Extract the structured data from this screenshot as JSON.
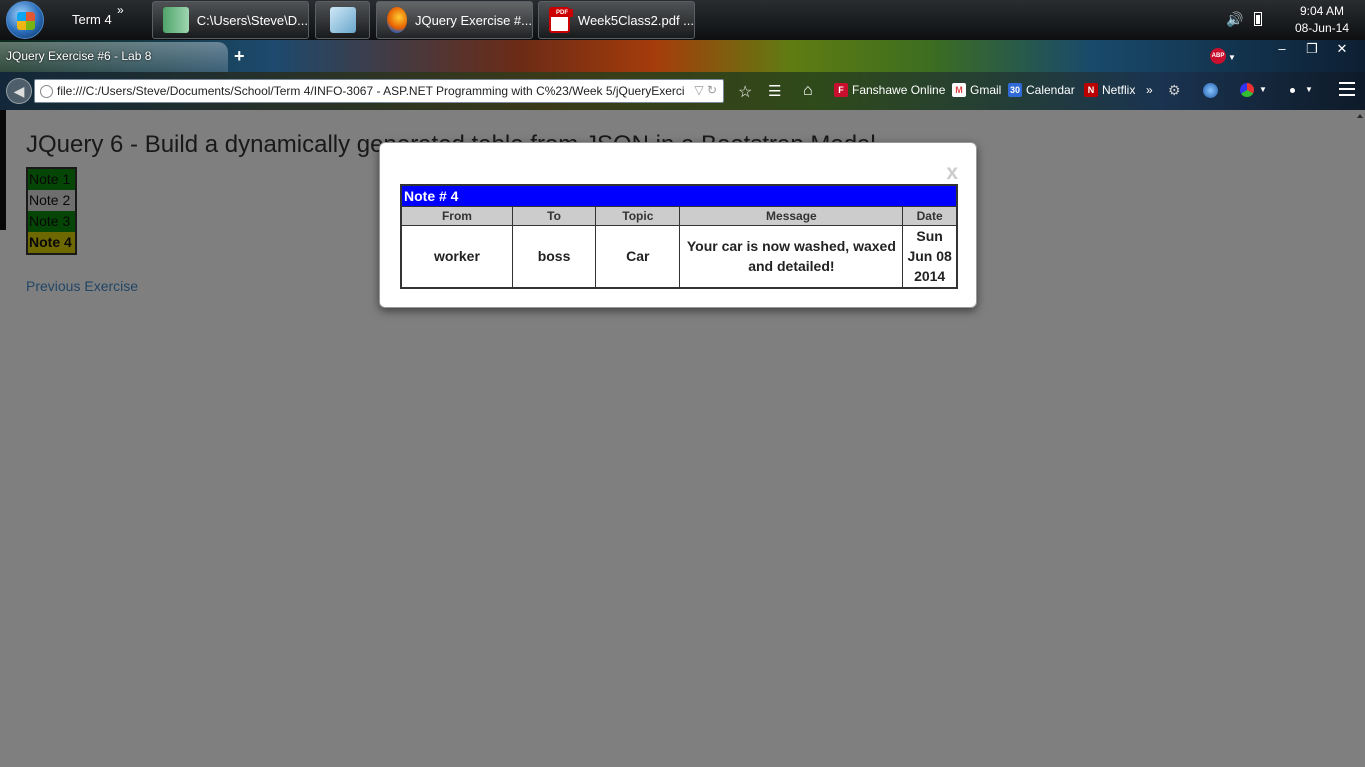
{
  "taskbar": {
    "toolbar_label": "Term 4",
    "toolbar_chevron": "»",
    "apps": [
      {
        "label": "C:\\Users\\Steve\\D..."
      },
      {
        "label": ""
      },
      {
        "label": "JQuery Exercise #..."
      },
      {
        "label": "Week5Class2.pdf ..."
      }
    ],
    "time": "9:04 AM",
    "date": "08-Jun-14"
  },
  "browser": {
    "tab_title": "JQuery Exercise #6 - Lab 8",
    "new_tab": "+",
    "url": "file:///C:/Users/Steve/Documents/School/Term 4/INFO-3067 - ASP.NET Programming with C%23/Week 5/jQueryExerci",
    "bookmarks": [
      {
        "label": "Fanshawe Online",
        "icon": "fanshawe-icon"
      },
      {
        "label": "Gmail",
        "icon": "gmail-icon"
      },
      {
        "label": "Calendar",
        "icon": "calendar-icon"
      },
      {
        "label": "Netflix",
        "icon": "netflix-icon"
      }
    ],
    "bookmarks_overflow": "»",
    "abp_label": "ABP"
  },
  "page": {
    "title": "JQuery 6 - Build a dynamically generated table from JSON in a Bootstrap Modal",
    "notes": [
      "Note 1",
      "Note 2",
      "Note 3",
      "Note 4"
    ],
    "previous_link": "Previous Exercise"
  },
  "modal": {
    "close": "x",
    "caption": "Note # 4",
    "columns": [
      "From",
      "To",
      "Topic",
      "Message",
      "Date"
    ],
    "row": {
      "from": "worker",
      "to": "boss",
      "topic": "Car",
      "message": "Your car is now washed, waxed and detailed!",
      "date": "Sun Jun 08 2014"
    }
  },
  "colors": {
    "caption_bg": "#0000ff",
    "note_green": "#0a8a0a",
    "note_yellow": "#ddd000",
    "link": "#428bca"
  }
}
